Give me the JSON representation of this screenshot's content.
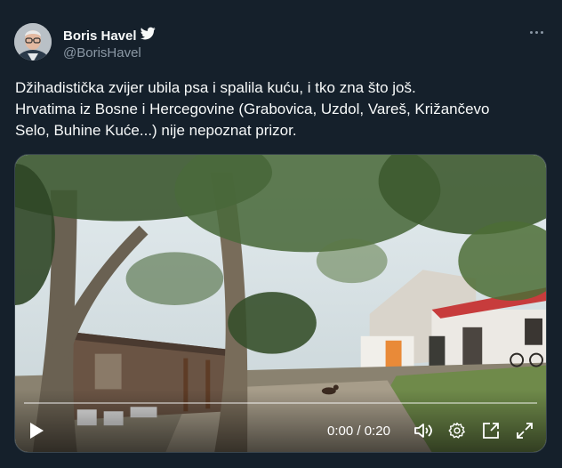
{
  "author": {
    "display_name": "Boris Havel",
    "handle": "@BorisHavel",
    "verified_icon": "twitter-bird-icon"
  },
  "tweet": {
    "lines": [
      "Džihadistička zvijer ubila psa i spalila kuću, i tko zna što još.",
      "Hrvatima iz Bosne i Hercegovine (Grabovica, Uzdol, Vareš, Križančevo",
      "Selo, Buhine Kuće...) nije nepoznat prizor."
    ]
  },
  "video": {
    "current_time": "0:00",
    "separator": "/",
    "duration": "0:20",
    "progress_fraction": 0,
    "icons": [
      "play-icon",
      "volume-icon",
      "settings-gear-icon",
      "pop-out-icon",
      "fullscreen-icon"
    ]
  },
  "colors": {
    "background": "#15202b",
    "text": "#f7f9f9",
    "secondary_text": "#8b98a5"
  }
}
